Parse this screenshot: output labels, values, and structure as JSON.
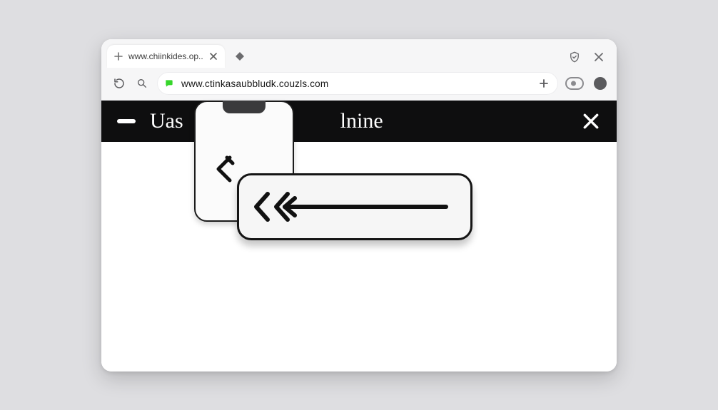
{
  "browser": {
    "tab": {
      "title": "www.chiinkides.op..",
      "plus_icon": "plus",
      "close_icon": "x"
    },
    "new_tab_icon": "diamond-plus",
    "window_controls": {
      "shield_icon": "shield",
      "close_icon": "x"
    },
    "toolbar": {
      "reload_icon": "reload",
      "search_icon": "search",
      "site_icon": "chat-bubble-green",
      "url": "www.ctinkasaubbludk.couzls.com",
      "add_icon": "plus",
      "extensions_icon": "pill-toggle",
      "profile_icon": "avatar-dot"
    }
  },
  "page": {
    "header": {
      "minimize_icon": "minus",
      "title_left": "Uas",
      "title_right": "lnine",
      "close_icon": "x"
    },
    "cards": {
      "notch_device_icon": "device-notch",
      "notch_back_icon": "chevron-left",
      "back_arrow_icon": "double-chevron-left-arrow"
    }
  },
  "colors": {
    "page_bg": "#dedee1",
    "window_bg": "#ffffff",
    "chrome_bg": "#f6f6f7",
    "header_bg": "#0e0e0f",
    "accent_green": "#37d62b",
    "stroke_dark": "#151515"
  }
}
